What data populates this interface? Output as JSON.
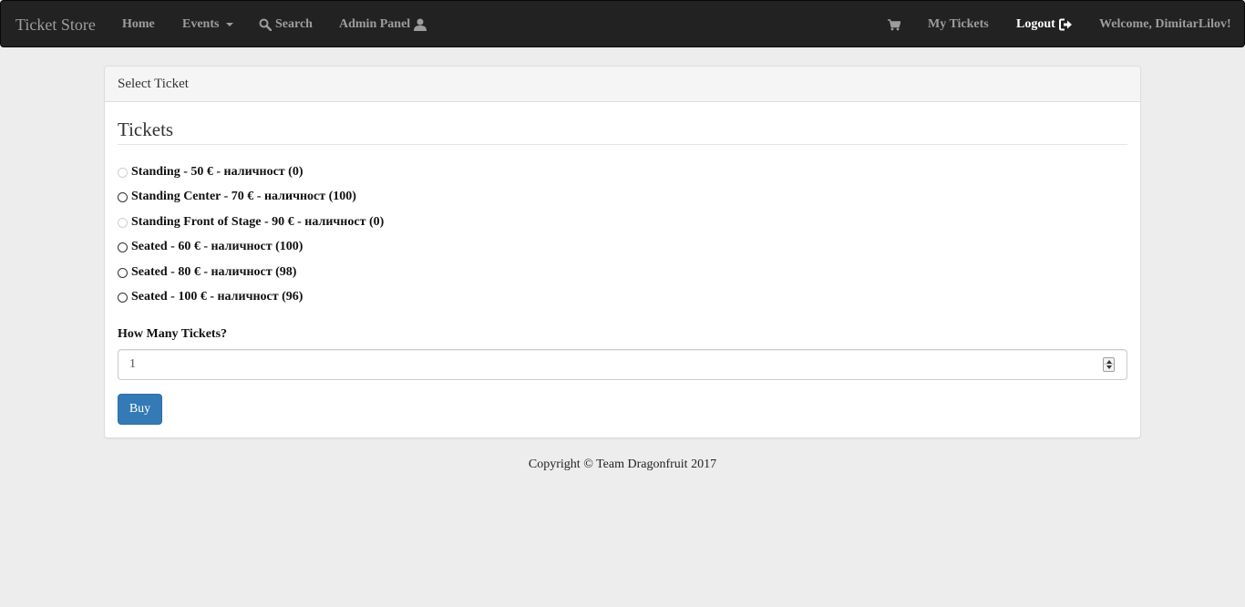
{
  "navbar": {
    "brand": "Ticket Store",
    "home": "Home",
    "events": "Events",
    "search": "Search",
    "admin_panel": "Admin Panel",
    "cart_icon": "shopping-cart-icon",
    "my_tickets": "My Tickets",
    "logout": "Logout",
    "welcome": "Welcome, DimitarLilov!"
  },
  "panel": {
    "heading": "Select Ticket",
    "legend": "Tickets",
    "options": [
      {
        "label": "Standing - 50 € - наличност (0)",
        "disabled": true
      },
      {
        "label": "Standing Center - 70 € - наличност (100)",
        "disabled": false
      },
      {
        "label": "Standing Front of Stage - 90 € - наличност (0)",
        "disabled": true
      },
      {
        "label": "Seated - 60 € - наличност (100)",
        "disabled": false
      },
      {
        "label": "Seated - 80 € - наличност (98)",
        "disabled": false
      },
      {
        "label": "Seated - 100 € - наличност (96)",
        "disabled": false
      }
    ],
    "quantity_label": "How Many Tickets?",
    "quantity_value": "1",
    "buy_label": "Buy"
  },
  "footer": {
    "copyright": "Copyright © Team Dragonfruit 2017"
  },
  "colors": {
    "navbar_bg": "#222222",
    "nav_text": "#9d9d9d",
    "nav_active": "#ffffff",
    "primary_button": "#337ab7",
    "page_bg": "#ededed"
  }
}
